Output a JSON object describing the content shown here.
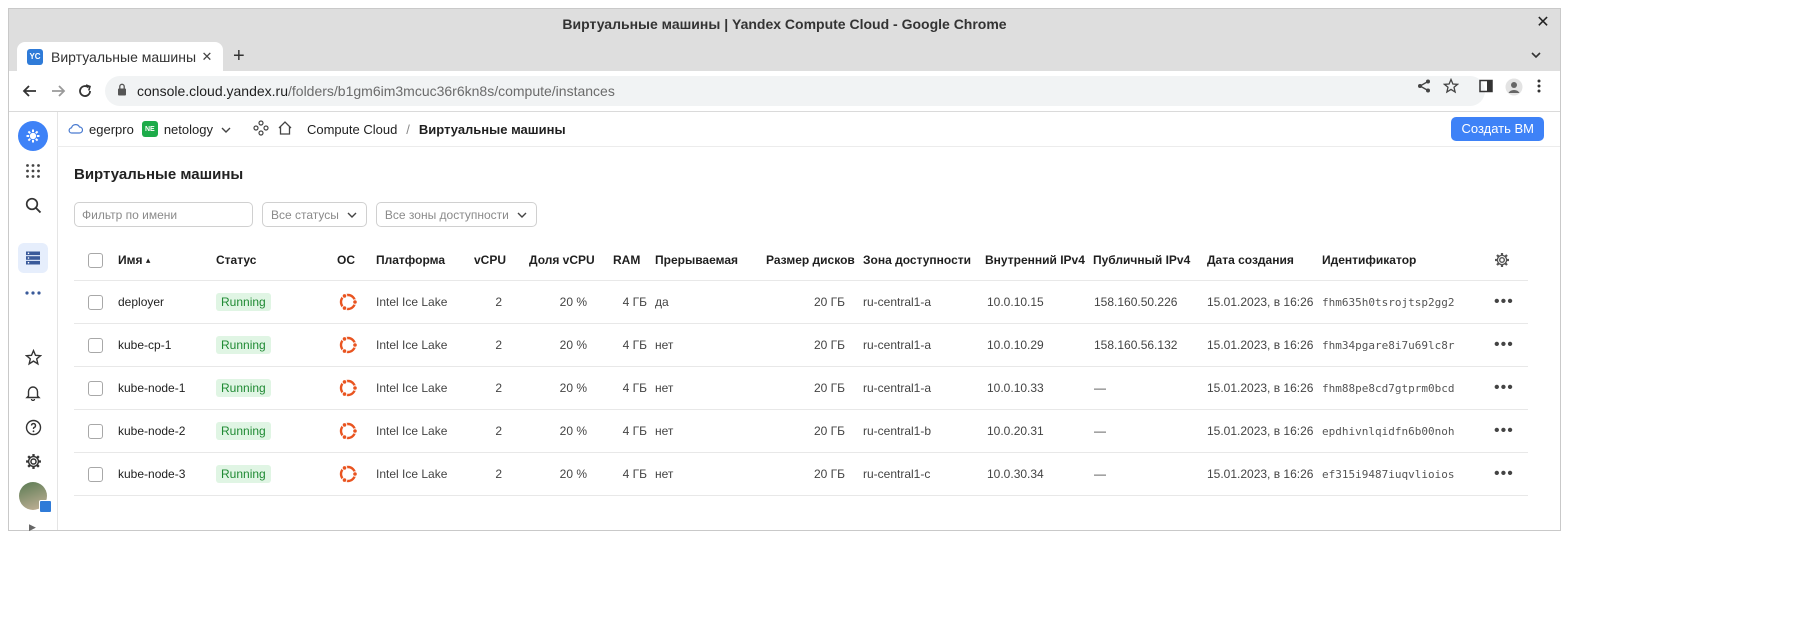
{
  "window": {
    "title": "Виртуальные машины | Yandex Compute Cloud - Google Chrome",
    "close_glyph": "✕"
  },
  "tabbar": {
    "tab_title": "Виртуальные машины | Y",
    "favicon_text": "YC",
    "tab_close_glyph": "✕",
    "new_tab_glyph": "+"
  },
  "addressbar": {
    "host": "console.cloud.yandex.ru",
    "path": "/folders/b1gm6im3mcuc36r6kn8s/compute/instances"
  },
  "header": {
    "cloud_name": "egerpro",
    "folder_badge": "NE",
    "folder_name": "netology",
    "breadcrumb_service": "Compute Cloud",
    "breadcrumb_separator": "/",
    "breadcrumb_current": "Виртуальные машины",
    "create_button": "Создать ВМ"
  },
  "page": {
    "title": "Виртуальные машины",
    "filter_placeholder": "Фильтр по имени",
    "status_select": "Все статусы",
    "zone_select": "Все зоны доступности"
  },
  "table": {
    "columns": {
      "name": "Имя",
      "name_sort": "▴",
      "status": "Статус",
      "os": "ОС",
      "platform": "Платформа",
      "vcpu": "vCPU",
      "vcpu_share": "Доля vCPU",
      "ram": "RAM",
      "preemptible": "Прерываемая",
      "disk": "Размер дисков",
      "zone": "Зона доступности",
      "internal_ip": "Внутренний IPv4",
      "public_ip": "Публичный IPv4",
      "created": "Дата создания",
      "id": "Идентификатор"
    },
    "rows": [
      {
        "name": "deployer",
        "status": "Running",
        "platform": "Intel Ice Lake",
        "vcpu": "2",
        "vcpu_share": "20 %",
        "ram": "4 ГБ",
        "preemptible": "да",
        "disk": "20 ГБ",
        "zone": "ru-central1-a",
        "internal_ip": "10.0.10.15",
        "public_ip": "158.160.50.226",
        "created": "15.01.2023, в 16:26",
        "id": "fhm635h0tsrojtsp2gg2",
        "more": "•••"
      },
      {
        "name": "kube-cp-1",
        "status": "Running",
        "platform": "Intel Ice Lake",
        "vcpu": "2",
        "vcpu_share": "20 %",
        "ram": "4 ГБ",
        "preemptible": "нет",
        "disk": "20 ГБ",
        "zone": "ru-central1-a",
        "internal_ip": "10.0.10.29",
        "public_ip": "158.160.56.132",
        "created": "15.01.2023, в 16:26",
        "id": "fhm34pgare8i7u69lc8r",
        "more": "•••"
      },
      {
        "name": "kube-node-1",
        "status": "Running",
        "platform": "Intel Ice Lake",
        "vcpu": "2",
        "vcpu_share": "20 %",
        "ram": "4 ГБ",
        "preemptible": "нет",
        "disk": "20 ГБ",
        "zone": "ru-central1-a",
        "internal_ip": "10.0.10.33",
        "public_ip": "—",
        "created": "15.01.2023, в 16:26",
        "id": "fhm88pe8cd7gtprm0bcd",
        "more": "•••"
      },
      {
        "name": "kube-node-2",
        "status": "Running",
        "platform": "Intel Ice Lake",
        "vcpu": "2",
        "vcpu_share": "20 %",
        "ram": "4 ГБ",
        "preemptible": "нет",
        "disk": "20 ГБ",
        "zone": "ru-central1-b",
        "internal_ip": "10.0.20.31",
        "public_ip": "—",
        "created": "15.01.2023, в 16:26",
        "id": "epdhivnlqidfn6b00noh",
        "more": "•••"
      },
      {
        "name": "kube-node-3",
        "status": "Running",
        "platform": "Intel Ice Lake",
        "vcpu": "2",
        "vcpu_share": "20 %",
        "ram": "4 ГБ",
        "preemptible": "нет",
        "disk": "20 ГБ",
        "zone": "ru-central1-c",
        "internal_ip": "10.0.30.34",
        "public_ip": "—",
        "created": "15.01.2023, в 16:26",
        "id": "ef315i9487iuqvlioios",
        "more": "•••"
      }
    ]
  },
  "colors": {
    "accent": "#3e82f7",
    "running_bg": "#e0f5e4",
    "running_text": "#1f8a33",
    "os_icon": "#e95420"
  }
}
